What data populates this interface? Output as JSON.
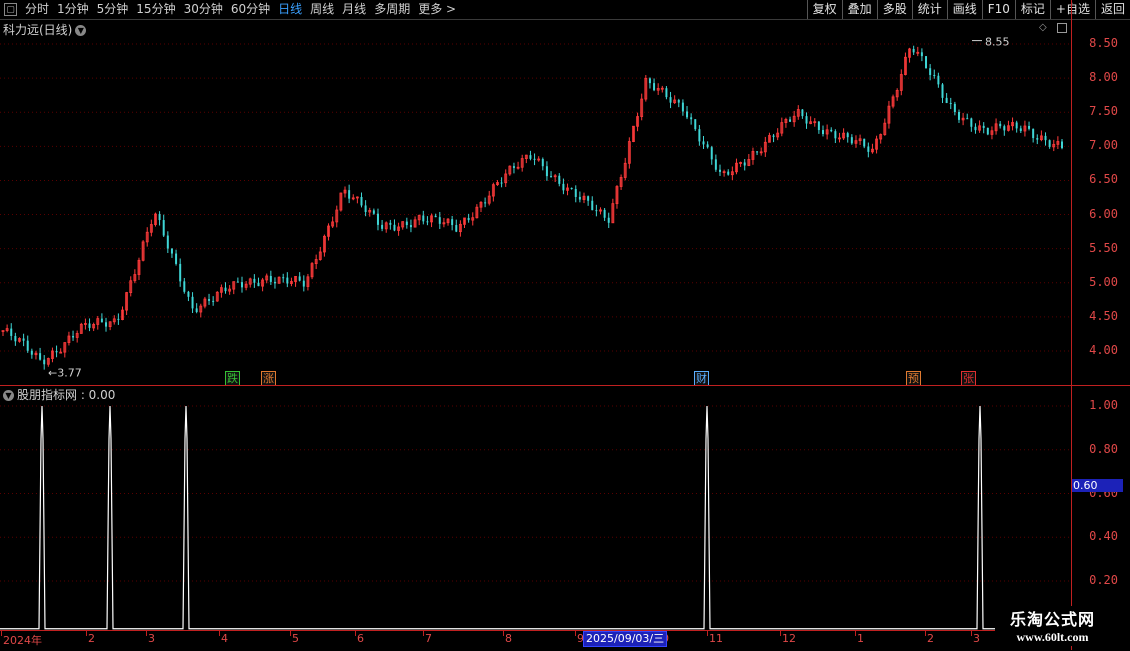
{
  "toolbar": {
    "periods": [
      "分时",
      "1分钟",
      "5分钟",
      "15分钟",
      "30分钟",
      "60分钟",
      "日线",
      "周线",
      "月线",
      "多周期",
      "更多 >"
    ],
    "active_period": "日线",
    "right_buttons": [
      "复权",
      "叠加",
      "多股",
      "统计",
      "画线",
      "F10",
      "标记",
      "+自选",
      "返回"
    ]
  },
  "price_pane": {
    "title": "科力远(日线)",
    "y_labels": [
      "8.50",
      "8.00",
      "7.50",
      "7.00",
      "6.50",
      "6.00",
      "5.50",
      "5.00",
      "4.50",
      "4.00"
    ],
    "high_label": "8.55",
    "low_label": "←3.77",
    "markers": [
      {
        "text": "跌",
        "color": "#35c035"
      },
      {
        "text": "涨",
        "color": "#e07a30"
      },
      {
        "text": "财",
        "color": "#5aaeff"
      },
      {
        "text": "预",
        "color": "#e07a30"
      },
      {
        "text": "张",
        "color": "#e03030"
      }
    ],
    "colors": {
      "up": "#ff3b3b",
      "down": "#3fd6d6",
      "grid": "#5a0000",
      "border": "#c02020"
    }
  },
  "indicator_pane": {
    "title": "股朋指标网 : 0.00",
    "y_labels": [
      "1.00",
      "0.80",
      "0.60",
      "0.40",
      "0.20"
    ],
    "cursor_value": "0.60",
    "signal_values": [
      1,
      1,
      1,
      1,
      1
    ]
  },
  "x_axis": {
    "labels": [
      "2024年",
      "2",
      "3",
      "4",
      "5",
      "6",
      "7",
      "8",
      "9",
      "0",
      "11",
      "12",
      "1",
      "2",
      "3"
    ],
    "cursor_date": "2025/09/03/三"
  },
  "watermark": {
    "cn": "乐淘公式网",
    "url": "www.60lt.com"
  },
  "chart_data": {
    "type": "line",
    "title": "科力远(日线)",
    "ylim": [
      3.7,
      8.7
    ],
    "x": [
      "2024年",
      "2",
      "3",
      "4",
      "5",
      "6",
      "7",
      "8",
      "9",
      "10",
      "11",
      "12",
      "1",
      "2",
      "3"
    ],
    "series": [
      {
        "values": [
          4.3,
          3.85,
          4.3,
          4.45,
          6.0,
          4.65,
          4.9,
          5.1,
          4.95,
          6.4,
          5.8,
          5.95,
          5.8,
          6.4,
          6.9,
          6.3,
          5.95,
          7.9,
          7.6,
          6.5,
          7.0,
          7.45,
          7.2,
          6.9,
          8.5,
          7.6,
          7.2,
          7.3,
          6.95
        ]
      }
    ],
    "high": 8.55,
    "low": 3.77,
    "indicator": {
      "name": "股朋指标网",
      "signal_months": [
        "2024年",
        "2",
        "3",
        "11",
        "3"
      ]
    }
  }
}
